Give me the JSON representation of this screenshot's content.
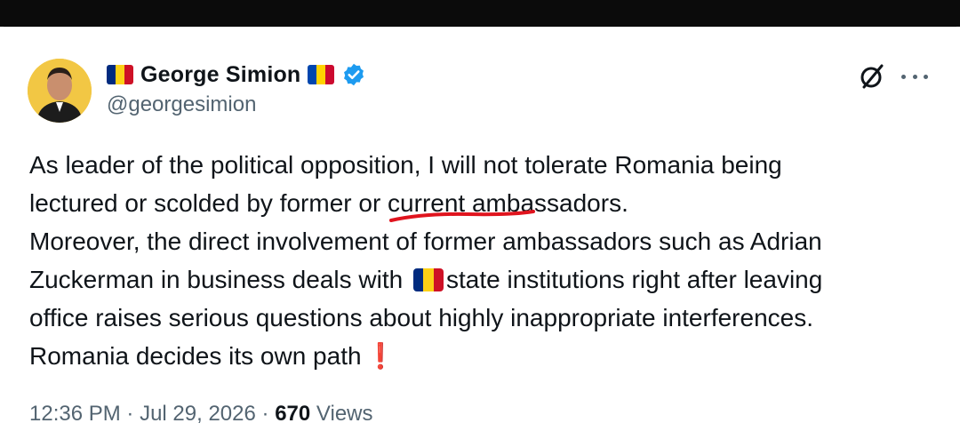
{
  "post": {
    "author": {
      "display_name": "George Simion",
      "handle": "@georgesimion",
      "verified": true,
      "flags": [
        "romania-flag",
        "moldova-flag"
      ]
    },
    "text_lines": [
      "As leader of the political opposition, I will not tolerate Romania being",
      "lectured or scolded by former or current ambassadors.",
      "Moreover, the direct involvement of former ambassadors such as Adrian",
      "Zuckerman in business deals with",
      "state institutions right after leaving",
      "office raises serious questions about highly inappropriate interferences.",
      "Romania decides its own path",
      "❗"
    ],
    "meta": {
      "time": "12:36 PM",
      "separator": "·",
      "date": "Jul 29, 2026",
      "views_count": "670",
      "views_label": "Views"
    },
    "icons": [
      "grok-icon",
      "more-icon",
      "verified-badge-icon"
    ],
    "colors": {
      "verified_blue": "#1d9bf0",
      "text_primary": "#0f1419",
      "text_secondary": "#536471",
      "annotation_red": "#e0141e"
    }
  }
}
